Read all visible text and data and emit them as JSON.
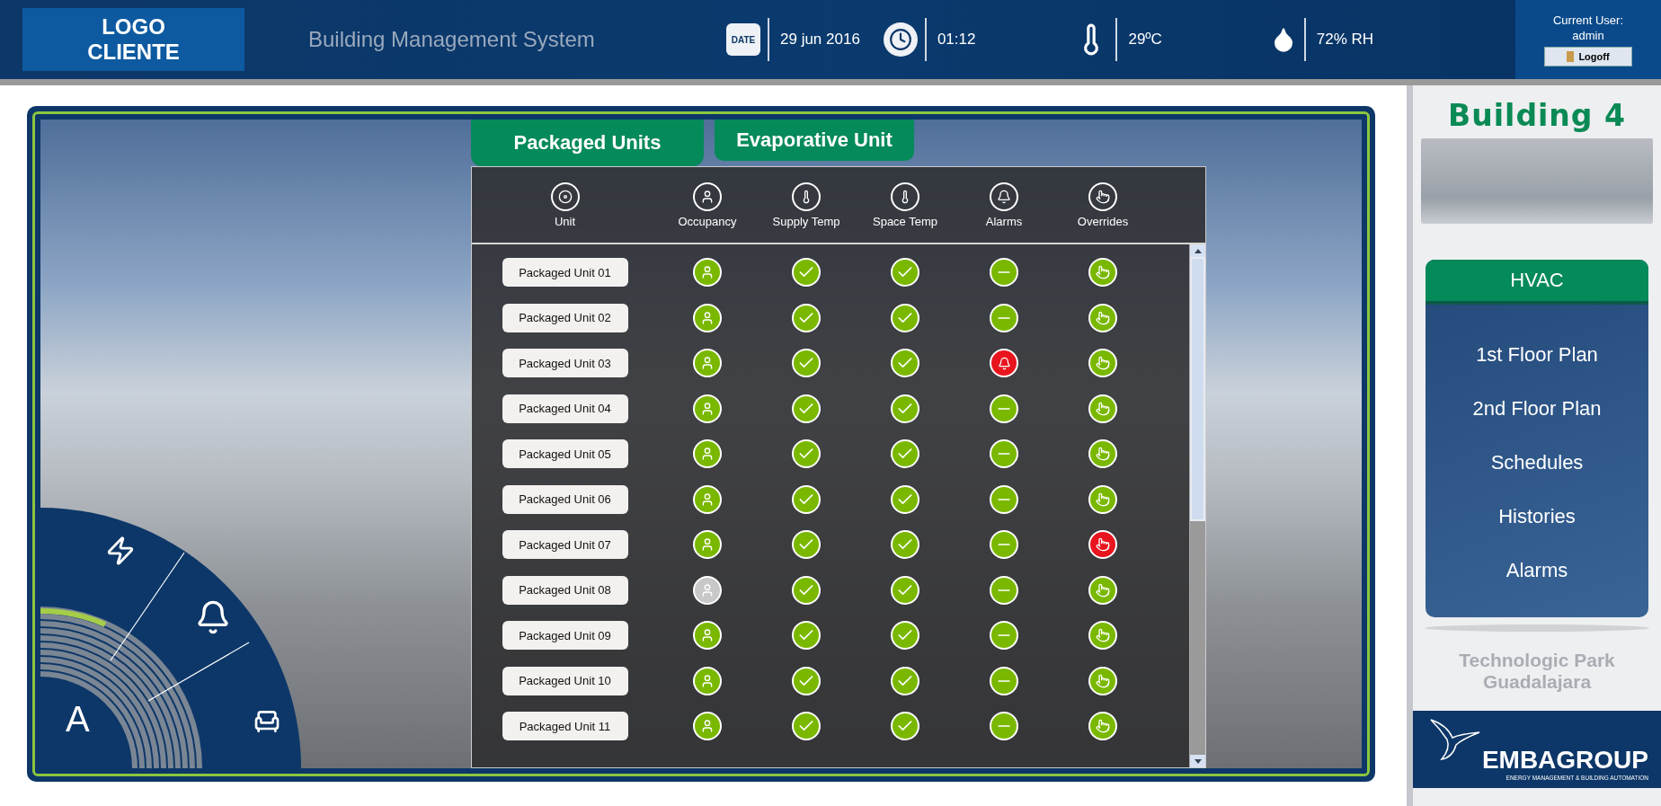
{
  "header": {
    "logo_lines": [
      "LOGO",
      "CLIENTE"
    ],
    "title": "Building Management System",
    "date": "29 jun 2016",
    "date_icon_label": "DATE",
    "time": "01:12",
    "temperature": "29ºC",
    "humidity": "72% RH",
    "user_label": "Current User:",
    "user_name": "admin",
    "logoff_button": "Logoff"
  },
  "tabs": [
    {
      "label": "Packaged Units",
      "selected": true
    },
    {
      "label": "Evaporative Unit",
      "selected": false
    }
  ],
  "columns": [
    {
      "label": "Unit",
      "kind": "unit"
    },
    {
      "label": "Occupancy",
      "kind": "occupancy"
    },
    {
      "label": "Supply Temp",
      "kind": "temp"
    },
    {
      "label": "Space Temp",
      "kind": "temp"
    },
    {
      "label": "Alarms",
      "kind": "alarm"
    },
    {
      "label": "Overrides",
      "kind": "override"
    }
  ],
  "rows": [
    {
      "unit": "Packaged Unit 01",
      "occupied": true,
      "supply_ok": true,
      "space_ok": true,
      "alarm": false,
      "override": false
    },
    {
      "unit": "Packaged Unit 02",
      "occupied": true,
      "supply_ok": true,
      "space_ok": true,
      "alarm": false,
      "override": false
    },
    {
      "unit": "Packaged Unit 03",
      "occupied": true,
      "supply_ok": true,
      "space_ok": true,
      "alarm": true,
      "override": false
    },
    {
      "unit": "Packaged Unit 04",
      "occupied": true,
      "supply_ok": true,
      "space_ok": true,
      "alarm": false,
      "override": false
    },
    {
      "unit": "Packaged Unit 05",
      "occupied": true,
      "supply_ok": true,
      "space_ok": true,
      "alarm": false,
      "override": false
    },
    {
      "unit": "Packaged Unit 06",
      "occupied": true,
      "supply_ok": true,
      "space_ok": true,
      "alarm": false,
      "override": false
    },
    {
      "unit": "Packaged Unit 07",
      "occupied": true,
      "supply_ok": true,
      "space_ok": true,
      "alarm": false,
      "override": true
    },
    {
      "unit": "Packaged Unit 08",
      "occupied": false,
      "supply_ok": true,
      "space_ok": true,
      "alarm": false,
      "override": false
    },
    {
      "unit": "Packaged Unit 09",
      "occupied": true,
      "supply_ok": true,
      "space_ok": true,
      "alarm": false,
      "override": false
    },
    {
      "unit": "Packaged Unit 10",
      "occupied": true,
      "supply_ok": true,
      "space_ok": true,
      "alarm": false,
      "override": false
    },
    {
      "unit": "Packaged Unit 11",
      "occupied": true,
      "supply_ok": true,
      "space_ok": true,
      "alarm": false,
      "override": false
    }
  ],
  "dial": {
    "letter": "A"
  },
  "sidebar": {
    "title": "Building 4",
    "menu_title": "HVAC",
    "items": [
      {
        "label": "1st Floor Plan"
      },
      {
        "label": "2nd Floor Plan"
      },
      {
        "label": "Schedules"
      },
      {
        "label": "Histories"
      },
      {
        "label": "Alarms"
      }
    ],
    "location_lines": [
      "Technologic Park",
      "Guadalajara"
    ],
    "brand": "EMBAGROUP",
    "brand_tagline": "ENERGY MANAGEMENT & BUILDING AUTOMATION"
  }
}
